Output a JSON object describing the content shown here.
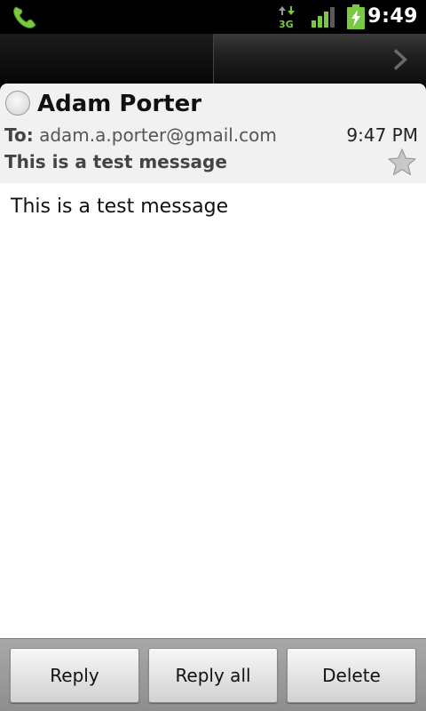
{
  "status_bar": {
    "time": "9:49",
    "network_type": "3G",
    "icons": [
      "call-icon",
      "data-3g-icon",
      "signal-icon",
      "battery-charging-icon"
    ],
    "accent_color": "#7ac943"
  },
  "message": {
    "sender": "Adam Porter",
    "to_label": "To:",
    "to_address": "adam.a.porter@gmail.com",
    "time": "9:47 PM",
    "subject": "This is a test message",
    "body": "This is a test message",
    "starred": false
  },
  "actions": {
    "reply": "Reply",
    "reply_all": "Reply all",
    "delete": "Delete"
  }
}
